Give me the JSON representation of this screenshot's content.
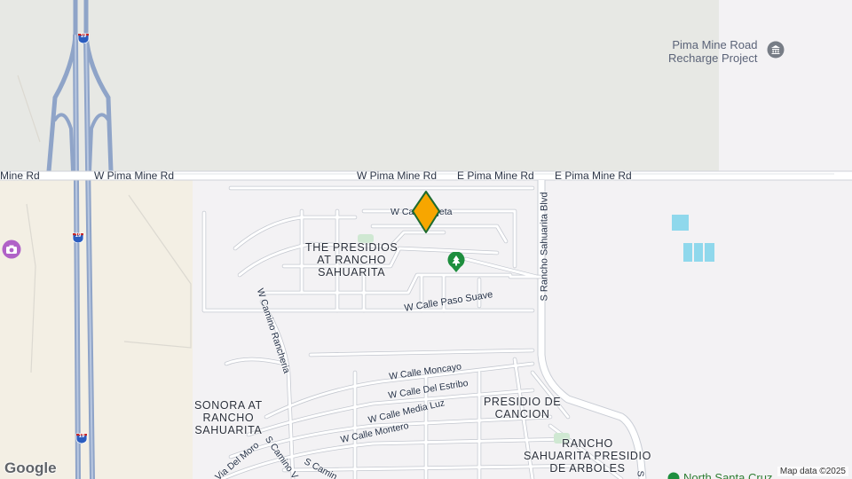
{
  "map": {
    "roads": {
      "w_pima_mine_rd_left": "Mine Rd",
      "w_pima_mine_rd_a": "W Pima Mine Rd",
      "w_pima_mine_rd_b": "W Pima Mine Rd",
      "e_pima_mine_rd_a": "E Pima Mine Rd",
      "e_pima_mine_rd_b": "E Pima Mine Rd",
      "s_rancho_sahuarita_blvd": "S Rancho Sahuarita Blvd",
      "w_camino_rancheria": "W Camino Rancheria",
      "w_calle_paso_suave": "W Calle Paso Suave",
      "w_calle_pajeta": "W Calle Pajeta",
      "w_calle_moncayo": "W Calle Moncayo",
      "w_calle_del_estribo": "W Calle Del Estribo",
      "w_calle_media_luz": "W Calle Media Luz",
      "w_calle_montero": "W Calle Montero",
      "via_del_moro": "Via Del Moro",
      "s_camino_v": "S Camino V",
      "s_camin": "S Camin",
      "right_edge_partial": "S"
    },
    "highway_shields": [
      "19",
      "19",
      "19"
    ],
    "neighborhoods": {
      "presidios": [
        "THE PRESIDIOS",
        "AT RANCHO",
        "SAHUARITA"
      ],
      "sonora": [
        "SONORA AT",
        "RANCHO",
        "SAHUARITA"
      ],
      "presidio_cancion": [
        "PRESIDIO DE",
        "CANCION"
      ],
      "rancho_arboles": [
        "RANCHO",
        "SAHUARITA PRESIDIO",
        "DE ARBOLES"
      ]
    },
    "pois": {
      "pima_mine_recharge": [
        "Pima Mine Road",
        "Recharge Project"
      ],
      "north_park_partial": "North Santa Cruz"
    },
    "icons": {
      "marker": "location-pin-icon",
      "park": "tree-icon",
      "museum": "museum-icon",
      "camera": "camera-icon"
    },
    "colors": {
      "marker_fill": "#f7a600",
      "marker_stroke": "#1e6b2f",
      "park_green": "#1e8e3e",
      "museum_gray": "#777d86",
      "camera_purple": "#b061c7",
      "highway": "#8fa4c8",
      "water": "#8fd8ec"
    },
    "attribution": "Map data ©2025",
    "logo": "Google"
  }
}
